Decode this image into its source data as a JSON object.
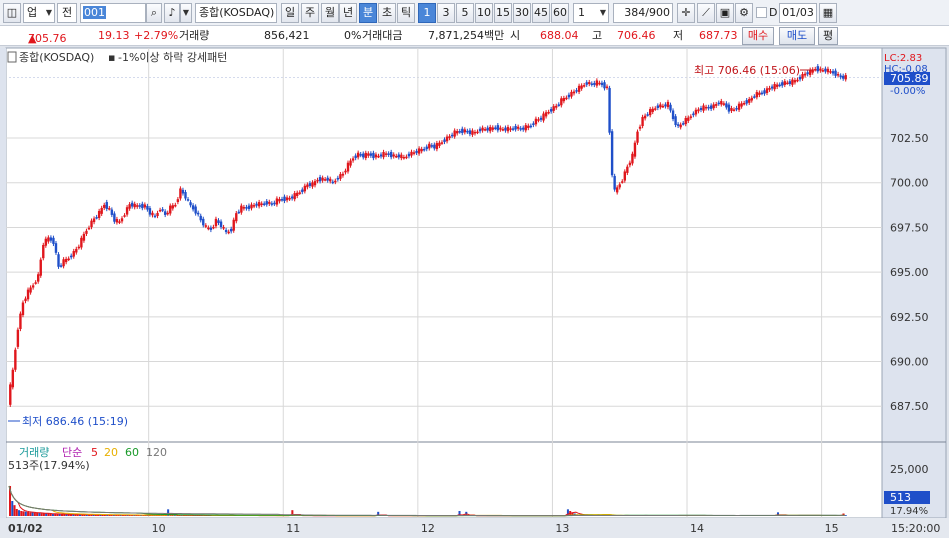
{
  "toolbar": {
    "chart_type_label": "업",
    "period_label": "전",
    "code_value": "001",
    "index_name": "종합(KOSDAQ)",
    "periods": [
      "일",
      "주",
      "월",
      "년",
      "분",
      "초",
      "틱"
    ],
    "active_period": "분",
    "intervals": [
      "1",
      "3",
      "5",
      "10",
      "15",
      "30",
      "45",
      "60"
    ],
    "active_interval": "1",
    "interval_select": "1",
    "count_value": "384",
    "count_total": "/900",
    "checkbox_label": "D",
    "date_value": "01/03"
  },
  "quote": {
    "price": "705.76",
    "change": "19.13",
    "change_pct": "+2.79%",
    "volume_label": "거래량",
    "volume_value": "856,421",
    "volume_pct": "0%",
    "amount_label": "거래대금",
    "amount_value": "7,871,254백만",
    "open_label": "시",
    "open_value": "688.04",
    "high_label": "고",
    "high_value": "706.46",
    "low_label": "저",
    "low_value": "687.73",
    "buy_label": "매수",
    "sell_label": "매도",
    "eval_label": "평"
  },
  "chart_data": {
    "type": "candlestick",
    "legend_main": "종합(KOSDAQ)",
    "legend_pattern": "-1%이상 하락 강세패턴",
    "high_annotation": "최고 706.46 (15:06)",
    "low_annotation": "최저 686.46 (15:19)",
    "lc_label": "LC:2.83",
    "hc_label": "HC:-0.08",
    "current_price_label": "705.89",
    "current_pct_label": "-0.00%",
    "ylim": [
      685.5,
      707.2
    ],
    "yticks": [
      "702.50",
      "700.00",
      "697.50",
      "695.00",
      "692.50",
      "690.00",
      "687.50"
    ],
    "ytick_values": [
      702.5,
      700.0,
      697.5,
      695.0,
      692.5,
      690.0,
      687.5
    ],
    "x_date_labels": [
      "01/02",
      "10",
      "11",
      "12",
      "13",
      "14",
      "15"
    ],
    "x_date_positions": [
      0,
      55,
      108,
      161,
      214,
      267,
      320
    ],
    "time_label": "15:20:00",
    "price_path": [
      [
        0,
        687.7
      ],
      [
        2,
        689.5
      ],
      [
        4,
        691.9
      ],
      [
        6,
        693.3
      ],
      [
        8,
        693.9
      ],
      [
        10,
        694.3
      ],
      [
        12,
        694.8
      ],
      [
        14,
        696.6
      ],
      [
        16,
        696.9
      ],
      [
        18,
        696.7
      ],
      [
        20,
        695.3
      ],
      [
        22,
        695.6
      ],
      [
        24,
        695.8
      ],
      [
        26,
        696.1
      ],
      [
        28,
        696.5
      ],
      [
        30,
        697.1
      ],
      [
        32,
        697.6
      ],
      [
        34,
        698.0
      ],
      [
        36,
        698.3
      ],
      [
        38,
        698.8
      ],
      [
        40,
        698.5
      ],
      [
        42,
        697.9
      ],
      [
        44,
        697.8
      ],
      [
        46,
        698.3
      ],
      [
        48,
        698.8
      ],
      [
        50,
        698.7
      ],
      [
        52,
        698.7
      ],
      [
        54,
        698.7
      ],
      [
        56,
        698.3
      ],
      [
        58,
        698.1
      ],
      [
        60,
        698.6
      ],
      [
        62,
        698.2
      ],
      [
        64,
        698.6
      ],
      [
        66,
        698.8
      ],
      [
        68,
        699.6
      ],
      [
        70,
        699.2
      ],
      [
        72,
        698.7
      ],
      [
        74,
        698.4
      ],
      [
        76,
        697.9
      ],
      [
        78,
        697.5
      ],
      [
        80,
        697.4
      ],
      [
        82,
        697.9
      ],
      [
        84,
        697.6
      ],
      [
        86,
        697.2
      ],
      [
        88,
        697.4
      ],
      [
        90,
        698.3
      ],
      [
        92,
        698.6
      ],
      [
        94,
        698.6
      ],
      [
        96,
        698.7
      ],
      [
        98,
        698.8
      ],
      [
        100,
        698.8
      ],
      [
        102,
        698.9
      ],
      [
        104,
        698.8
      ],
      [
        106,
        699.0
      ],
      [
        108,
        699.1
      ],
      [
        110,
        699.1
      ],
      [
        112,
        699.2
      ],
      [
        114,
        699.4
      ],
      [
        116,
        699.6
      ],
      [
        118,
        699.9
      ],
      [
        120,
        699.9
      ],
      [
        122,
        700.2
      ],
      [
        124,
        700.2
      ],
      [
        126,
        700.2
      ],
      [
        128,
        700.0
      ],
      [
        130,
        700.3
      ],
      [
        132,
        700.5
      ],
      [
        134,
        701.0
      ],
      [
        136,
        701.4
      ],
      [
        138,
        701.6
      ],
      [
        140,
        701.5
      ],
      [
        142,
        701.6
      ],
      [
        144,
        701.5
      ],
      [
        146,
        701.5
      ],
      [
        148,
        701.6
      ],
      [
        150,
        701.6
      ],
      [
        152,
        701.5
      ],
      [
        154,
        701.5
      ],
      [
        156,
        701.4
      ],
      [
        158,
        701.6
      ],
      [
        160,
        701.7
      ],
      [
        162,
        701.8
      ],
      [
        164,
        701.9
      ],
      [
        166,
        702.1
      ],
      [
        168,
        702.0
      ],
      [
        170,
        702.2
      ],
      [
        172,
        702.4
      ],
      [
        174,
        702.6
      ],
      [
        176,
        702.8
      ],
      [
        178,
        702.9
      ],
      [
        180,
        702.9
      ],
      [
        182,
        702.8
      ],
      [
        184,
        702.8
      ],
      [
        186,
        703.0
      ],
      [
        188,
        703.0
      ],
      [
        190,
        703.0
      ],
      [
        192,
        703.1
      ],
      [
        194,
        703.0
      ],
      [
        196,
        703.0
      ],
      [
        198,
        703.0
      ],
      [
        200,
        703.1
      ],
      [
        202,
        703.0
      ],
      [
        204,
        703.1
      ],
      [
        206,
        703.2
      ],
      [
        208,
        703.5
      ],
      [
        210,
        703.6
      ],
      [
        212,
        703.9
      ],
      [
        214,
        704.1
      ],
      [
        216,
        704.3
      ],
      [
        218,
        704.6
      ],
      [
        220,
        704.8
      ],
      [
        222,
        705.0
      ],
      [
        224,
        705.2
      ],
      [
        226,
        705.4
      ],
      [
        228,
        705.6
      ],
      [
        230,
        705.5
      ],
      [
        232,
        705.6
      ],
      [
        234,
        705.5
      ],
      [
        236,
        705.3
      ],
      [
        237,
        702.8
      ],
      [
        238,
        700.5
      ],
      [
        239,
        699.5
      ],
      [
        240,
        699.7
      ],
      [
        242,
        700.2
      ],
      [
        244,
        700.9
      ],
      [
        246,
        701.5
      ],
      [
        248,
        702.9
      ],
      [
        250,
        703.6
      ],
      [
        252,
        703.9
      ],
      [
        254,
        704.1
      ],
      [
        256,
        704.3
      ],
      [
        258,
        704.3
      ],
      [
        260,
        704.4
      ],
      [
        262,
        703.6
      ],
      [
        264,
        703.1
      ],
      [
        266,
        703.4
      ],
      [
        268,
        703.6
      ],
      [
        270,
        703.9
      ],
      [
        272,
        704.1
      ],
      [
        274,
        704.2
      ],
      [
        276,
        704.2
      ],
      [
        278,
        704.3
      ],
      [
        280,
        704.5
      ],
      [
        282,
        704.4
      ],
      [
        284,
        704.1
      ],
      [
        286,
        704.1
      ],
      [
        288,
        704.3
      ],
      [
        290,
        704.5
      ],
      [
        292,
        704.6
      ],
      [
        294,
        704.9
      ],
      [
        296,
        705.0
      ],
      [
        298,
        705.1
      ],
      [
        300,
        705.3
      ],
      [
        302,
        705.4
      ],
      [
        304,
        705.5
      ],
      [
        306,
        705.6
      ],
      [
        308,
        705.6
      ],
      [
        310,
        705.7
      ],
      [
        312,
        705.9
      ],
      [
        314,
        706.1
      ],
      [
        316,
        706.2
      ],
      [
        318,
        706.4
      ],
      [
        320,
        706.3
      ],
      [
        322,
        706.3
      ],
      [
        324,
        706.2
      ],
      [
        326,
        706.1
      ],
      [
        328,
        705.9
      ],
      [
        330,
        705.9
      ]
    ],
    "volume": {
      "legend_label": "거래량",
      "ma_label": "단순",
      "ma_periods": [
        "5",
        "20",
        "60",
        "120"
      ],
      "ma_colors": [
        "#e0161c",
        "#e8b000",
        "#1a9a2a",
        "#777777"
      ],
      "current_label": "513주(17.94%)",
      "ylim": [
        0,
        30000
      ],
      "ytick": "25,000",
      "ytick_value": 25000,
      "current_value_label": "513",
      "current_pct_label": "17.94%",
      "bars": [
        18000,
        9000,
        6500,
        4200,
        3500,
        3000,
        2800,
        2600,
        2400,
        2200,
        2100,
        2000,
        1900,
        1800,
        1700,
        1600,
        1500,
        1500,
        1400,
        1300,
        1300,
        1200,
        1200,
        1100,
        1100,
        1100,
        1000,
        1000,
        1000,
        900,
        900,
        900,
        900,
        850,
        850,
        800,
        800,
        800,
        750,
        750,
        750,
        700,
        700,
        700,
        700,
        650,
        650,
        650,
        600,
        600,
        600,
        600,
        600,
        580,
        560,
        540,
        520,
        520,
        500,
        500,
        500,
        480,
        480,
        460,
        460,
        450,
        450,
        440,
        430,
        420,
        4000,
        420,
        410,
        400,
        400,
        390,
        390,
        380,
        380,
        380,
        370,
        370,
        360,
        360,
        350,
        350,
        350,
        340,
        340,
        330,
        330,
        330,
        320,
        320,
        320,
        310,
        310,
        310,
        300,
        300,
        300,
        290,
        290,
        290,
        280,
        280,
        280,
        280,
        270,
        270,
        270,
        260,
        260,
        260,
        250,
        250,
        250,
        250,
        240,
        240,
        240,
        240,
        230,
        230,
        230,
        3500,
        230,
        220,
        220,
        220,
        220,
        210,
        210,
        210,
        210,
        200,
        200,
        200,
        200,
        200,
        190,
        190,
        190,
        190,
        180,
        180,
        180,
        180,
        180,
        170,
        170,
        170,
        170,
        160,
        160,
        160,
        160,
        160,
        150,
        150,
        150,
        150,
        150,
        2500,
        150,
        140,
        140,
        140,
        140,
        140,
        130,
        130,
        130,
        130,
        130,
        130,
        120,
        120,
        120,
        120,
        120,
        110,
        110,
        110,
        110,
        110,
        110,
        100,
        100,
        100,
        100,
        100,
        100,
        100,
        100,
        100,
        100,
        100,
        100,
        3000,
        100,
        100,
        2500,
        100,
        100,
        100,
        100,
        100,
        100,
        100,
        100,
        100,
        100,
        100,
        100,
        100,
        100,
        100,
        100,
        100,
        100,
        100,
        100,
        100,
        100,
        100,
        100,
        100,
        100,
        100,
        100,
        100,
        100,
        100,
        100,
        100,
        100,
        100,
        100,
        100,
        100,
        100,
        100,
        100,
        100,
        100,
        100,
        4000,
        3000,
        2000,
        1500,
        1000,
        900,
        800,
        700,
        600,
        500,
        400,
        350,
        300,
        300,
        300,
        300,
        300,
        300,
        300,
        300,
        300,
        300,
        300,
        300,
        300,
        300,
        300,
        300,
        300,
        300,
        300,
        300,
        300,
        300,
        300,
        300,
        300,
        300,
        300,
        300,
        300,
        300,
        300,
        300,
        300,
        300,
        300,
        300,
        300,
        300,
        300,
        300,
        300,
        300,
        300,
        300,
        300,
        300,
        300,
        300,
        300,
        300,
        300,
        300,
        300,
        300,
        300,
        300,
        300,
        300,
        300,
        300,
        300,
        300,
        300,
        300,
        300,
        300,
        300,
        300,
        300,
        300,
        300,
        300,
        300,
        300,
        300,
        300,
        300,
        300,
        300,
        300,
        300,
        2200,
        300,
        300,
        300,
        300,
        300,
        300,
        300,
        300,
        300,
        300,
        300,
        300,
        300,
        300,
        300,
        300,
        300,
        300,
        300,
        300,
        300,
        300,
        300,
        300,
        300,
        300,
        300,
        300,
        1500,
        513
      ]
    }
  },
  "colors": {
    "up": "#e0161c",
    "down": "#1f4fc9",
    "grid": "#d8d8d8",
    "axis_bg": "#dde3ee",
    "current_box": "#1f4fc9"
  }
}
